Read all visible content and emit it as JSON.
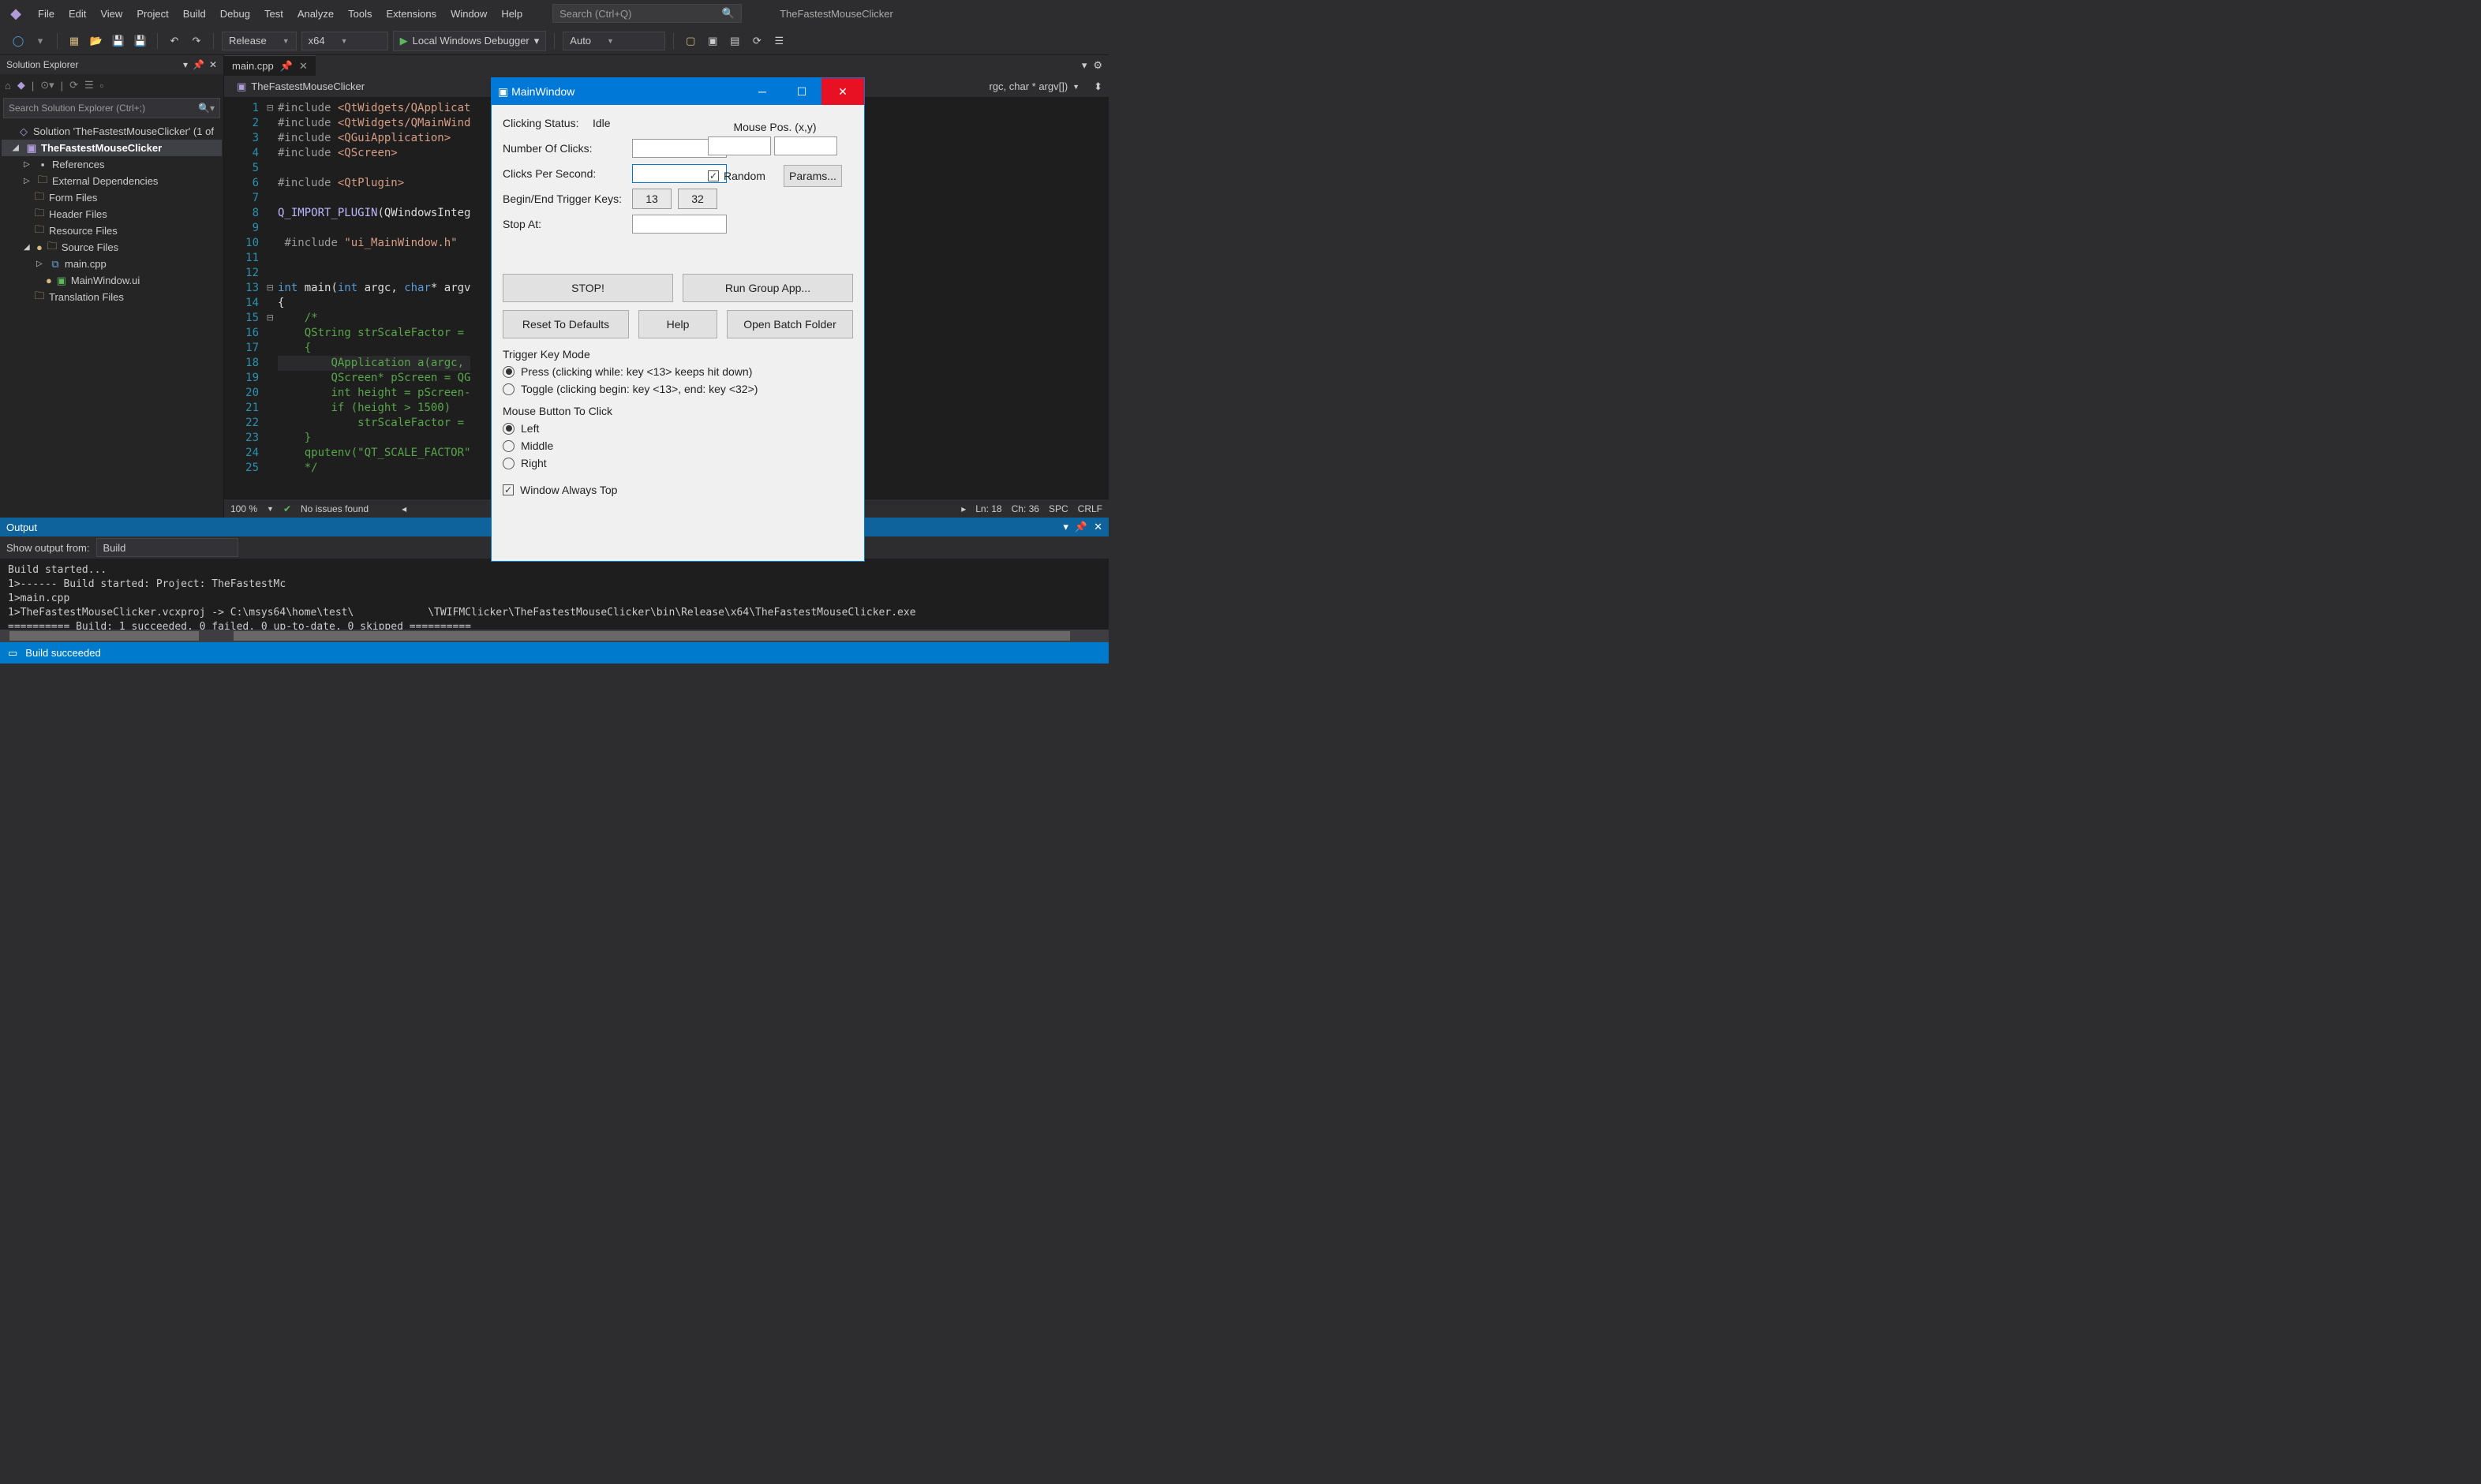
{
  "menu": {
    "file": "File",
    "edit": "Edit",
    "view": "View",
    "project": "Project",
    "build": "Build",
    "debug": "Debug",
    "test": "Test",
    "analyze": "Analyze",
    "tools": "Tools",
    "extensions": "Extensions",
    "window": "Window",
    "help": "Help"
  },
  "titlebar": {
    "search_placeholder": "Search (Ctrl+Q)",
    "solution_title": "TheFastestMouseClicker"
  },
  "toolbar": {
    "config": "Release",
    "platform": "x64",
    "debugger": "Local Windows Debugger",
    "auto": "Auto"
  },
  "solution_explorer": {
    "title": "Solution Explorer",
    "search_placeholder": "Search Solution Explorer (Ctrl+;)",
    "root": "Solution 'TheFastestMouseClicker' (1 of",
    "project": "TheFastestMouseClicker",
    "items": [
      "References",
      "External Dependencies",
      "Form Files",
      "Header Files",
      "Resource Files",
      "Source Files",
      "Translation Files"
    ],
    "src_items": [
      "main.cpp",
      "MainWindow.ui"
    ]
  },
  "editor": {
    "tab": "main.cpp",
    "combo_project": "TheFastestMouseClicker",
    "combo_scope": "rgc, char * argv[])",
    "zoom": "100 %",
    "issues": "No issues found",
    "status": {
      "ln": "Ln: 18",
      "ch": "Ch: 36",
      "spc": "SPC",
      "crlf": "CRLF"
    }
  },
  "code": {
    "lines": [
      {
        "n": 1,
        "html": "<span class='pp'>#include</span> <span class='str'>&lt;QtWidgets/QApplicat</span>"
      },
      {
        "n": 2,
        "html": "<span class='pp'>#include</span> <span class='str'>&lt;QtWidgets/QMainWind</span>"
      },
      {
        "n": 3,
        "html": "<span class='pp'>#include</span> <span class='str'>&lt;QGuiApplication&gt;</span>"
      },
      {
        "n": 4,
        "html": "<span class='pp'>#include</span> <span class='str'>&lt;QScreen&gt;</span>"
      },
      {
        "n": 5,
        "html": ""
      },
      {
        "n": 6,
        "html": "<span class='pp'>#include</span> <span class='str'>&lt;QtPlugin&gt;</span>"
      },
      {
        "n": 7,
        "html": ""
      },
      {
        "n": 8,
        "html": "<span class='mac'>Q_IMPORT_PLUGIN</span>(QWindowsInteg"
      },
      {
        "n": 9,
        "html": ""
      },
      {
        "n": 10,
        "html": " <span class='pp'>#include</span> <span class='str'>\"ui_MainWindow.h\"</span>"
      },
      {
        "n": 11,
        "html": ""
      },
      {
        "n": 12,
        "html": ""
      },
      {
        "n": 13,
        "html": "<span class='kw'>int</span> main(<span class='kw'>int</span> argc, <span class='kw'>char</span>* argv"
      },
      {
        "n": 14,
        "html": "{"
      },
      {
        "n": 15,
        "html": "    <span class='com'>/*</span>"
      },
      {
        "n": 16,
        "html": "    <span class='com'>QString strScaleFactor = </span>"
      },
      {
        "n": 17,
        "html": "    <span class='com'>{</span>"
      },
      {
        "n": 18,
        "html": "        <span class='com'>QApplication a(argc, </span>"
      },
      {
        "n": 19,
        "html": "        <span class='com'>QScreen* pScreen = QG</span>"
      },
      {
        "n": 20,
        "html": "        <span class='com'>int height = pScreen-</span>"
      },
      {
        "n": 21,
        "html": "        <span class='com'>if (height &gt; 1500)</span>"
      },
      {
        "n": 22,
        "html": "            <span class='com'>strScaleFactor = </span>"
      },
      {
        "n": 23,
        "html": "    <span class='com'>}</span>"
      },
      {
        "n": 24,
        "html": "    <span class='com'>qputenv(\"QT_SCALE_FACTOR\"</span>"
      },
      {
        "n": 25,
        "html": "    <span class='com'>*/</span>"
      }
    ]
  },
  "output": {
    "title": "Output",
    "from_label": "Show output from:",
    "from_value": "Build",
    "body": "Build started...\n1>------ Build started: Project: TheFastestMc\n1>main.cpp\n1>TheFastestMouseClicker.vcxproj -> C:\\msys64\\home\\test\\            \\TWIFMClicker\\TheFastestMouseClicker\\bin\\Release\\x64\\TheFastestMouseClicker.exe\n========== Build: 1 succeeded, 0 failed, 0 up-to-date, 0 skipped =========="
  },
  "statusbar": {
    "text": "Build succeeded"
  },
  "dialog": {
    "title": "MainWindow",
    "status_label": "Clicking Status:",
    "status_value": "Idle",
    "num_clicks": "Number Of Clicks:",
    "cps": "Clicks Per Second:",
    "trigger": "Begin/End Trigger Keys:",
    "trigger_k1": "13",
    "trigger_k2": "32",
    "stop_at": "Stop At:",
    "mouse_pos": "Mouse Pos. (x,y)",
    "random": "Random",
    "params": "Params...",
    "btn_stop": "STOP!",
    "btn_group": "Run Group App...",
    "btn_reset": "Reset To Defaults",
    "btn_help": "Help",
    "btn_batch": "Open Batch Folder",
    "tkm_title": "Trigger Key Mode",
    "tkm_press": "Press (clicking while: key <13> keeps hit down)",
    "tkm_toggle": "Toggle (clicking begin: key <13>, end: key <32>)",
    "mbtn_title": "Mouse Button To Click",
    "mbtn_left": "Left",
    "mbtn_middle": "Middle",
    "mbtn_right": "Right",
    "always_top": "Window Always Top"
  }
}
